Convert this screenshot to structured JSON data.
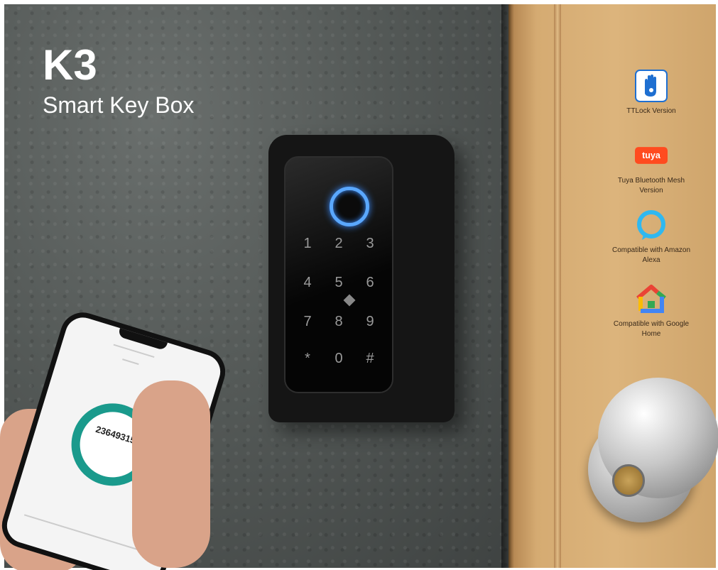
{
  "product": {
    "model": "K3",
    "name": "Smart Key Box"
  },
  "keypad": {
    "keys": [
      "1",
      "2",
      "3",
      "4",
      "5",
      "6",
      "7",
      "8",
      "9",
      "*",
      "0",
      "#"
    ]
  },
  "phone_screen": {
    "code": "23649315"
  },
  "features": [
    {
      "icon": "ttlock-hand-icon",
      "label": "TTLock Version",
      "color": "#1e6fd1"
    },
    {
      "icon": "tuya-logo",
      "label": "Tuya Bluetooth Mesh Version",
      "logo_text": "tuya",
      "color": "#ff4b1f"
    },
    {
      "icon": "alexa-ring-icon",
      "label": "Compatible with Amazon Alexa",
      "color": "#2fb8f0"
    },
    {
      "icon": "google-home-icon",
      "label": "Compatible with Google Home",
      "color": "#4285f4"
    }
  ]
}
